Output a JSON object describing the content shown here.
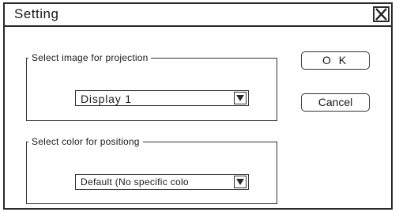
{
  "window": {
    "title": "Setting",
    "close_icon": "close-x-icon"
  },
  "projection_group": {
    "legend": "Select image for projection",
    "selected_value": "Display 1",
    "dropdown_icon": "chevron-down-icon"
  },
  "positioning_group": {
    "legend": "Select color for positiong",
    "selected_value": "Default (No specific colo",
    "dropdown_icon": "chevron-down-icon"
  },
  "buttons": {
    "ok_label": "O K",
    "cancel_label": "Cancel"
  }
}
